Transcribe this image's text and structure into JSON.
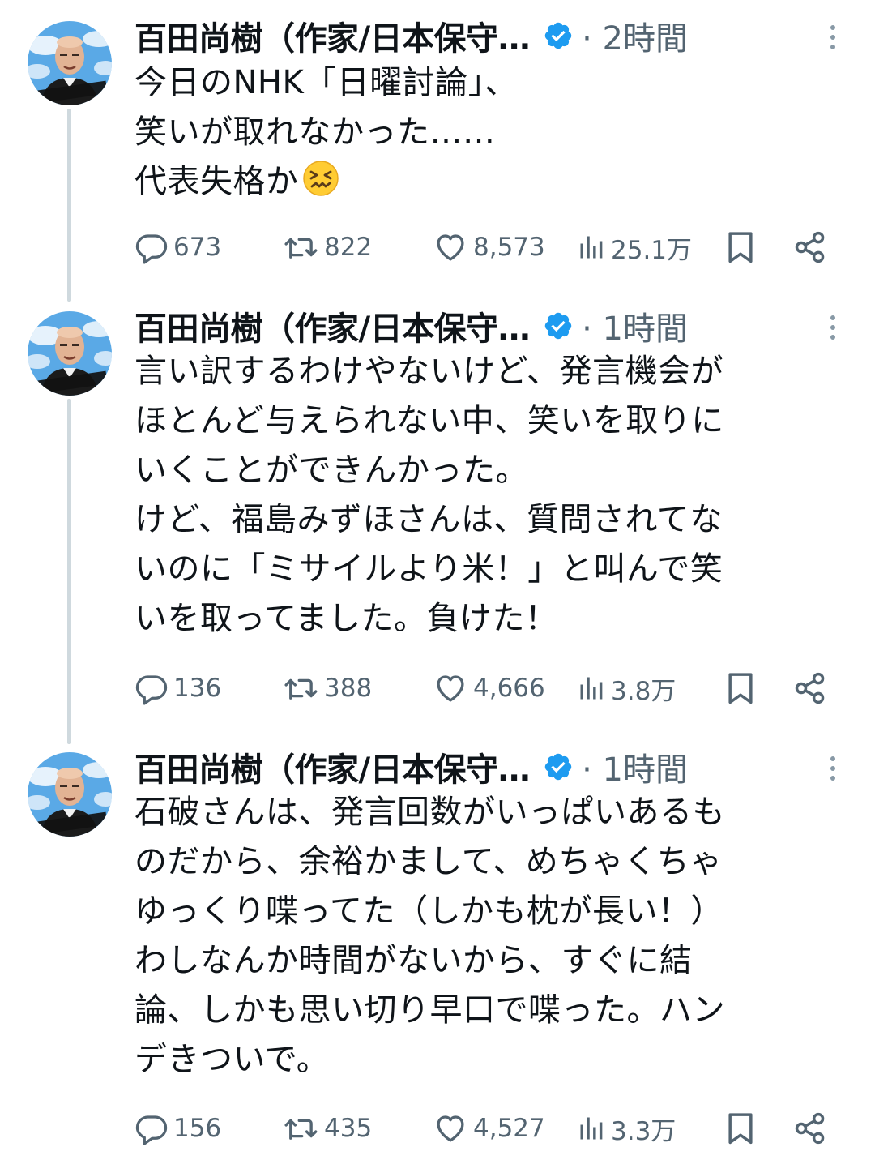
{
  "tweets": [
    {
      "author": "百田尚樹（作家/日本保守…",
      "time": "· 2時間",
      "text": "今日のNHK「日曜討論」、\n笑いが取れなかった……\n代表失格か",
      "emoji": "confounded-face",
      "replies": "673",
      "retweets": "822",
      "likes": "8,573",
      "views": "25.1万"
    },
    {
      "author": "百田尚樹（作家/日本保守…",
      "time": "· 1時間",
      "text": "言い訳するわけやないけど、発言機会が\nほとんど与えられない中、笑いを取りに\nいくことができんかった。\nけど、福島みずほさんは、質問されてな\nいのに「ミサイルより米！」と叫んで笑\nいを取ってました。負けた！",
      "replies": "136",
      "retweets": "388",
      "likes": "4,666",
      "views": "3.8万"
    },
    {
      "author": "百田尚樹（作家/日本保守…",
      "time": "· 1時間",
      "text": "石破さんは、発言回数がいっぱいあるも\nのだから、余裕かまして、めちゃくちゃ\nゆっくり喋ってた（しかも枕が長い！）\nわしなんか時間がないから、すぐに結\n論、しかも思い切り早口で喋った。ハン\nデきついで。",
      "replies": "156",
      "retweets": "435",
      "likes": "4,527",
      "views": "3.3万"
    }
  ],
  "avatar_signature": "百田尚樹",
  "colors": {
    "text": "#0f1419",
    "secondary": "#536471",
    "verified": "#1d9bf0",
    "thread_line": "#cfd9de",
    "avatar_sky": "#5aa9e6"
  },
  "icons": [
    "reply-icon",
    "retweet-icon",
    "like-icon",
    "views-icon",
    "bookmark-icon",
    "share-icon",
    "verified-badge-icon",
    "more-icon"
  ]
}
